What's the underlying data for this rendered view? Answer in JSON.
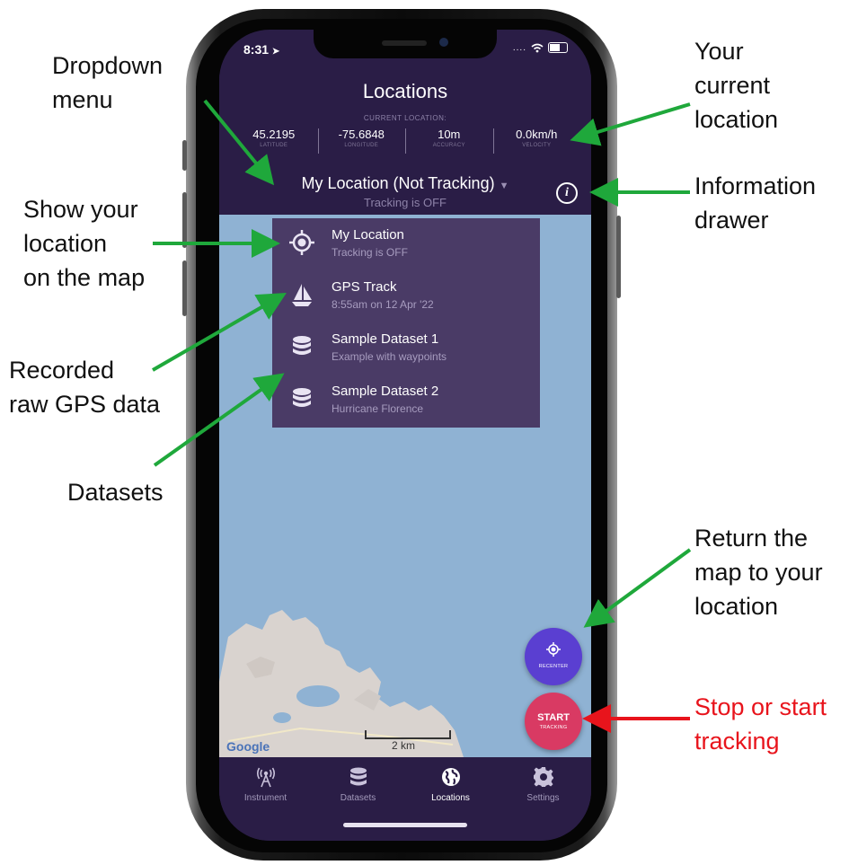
{
  "status_bar": {
    "time": "8:31",
    "signal": "...."
  },
  "header": {
    "title": "Locations",
    "current_location_label": "CURRENT LOCATION:",
    "stats": [
      {
        "value": "45.2195",
        "label": "LATITUDE"
      },
      {
        "value": "-75.6848",
        "label": "LONGITUDE"
      },
      {
        "value": "10m",
        "label": "ACCURACY"
      },
      {
        "value": "0.0km/h",
        "label": "VELOCITY"
      }
    ],
    "dropdown": {
      "title": "My Location (Not Tracking)",
      "caret": "▼",
      "subtitle": "Tracking is OFF"
    },
    "info_button": "i"
  },
  "menu": {
    "items": [
      {
        "title": "My Location",
        "subtitle": "Tracking is OFF",
        "icon": "crosshair-icon"
      },
      {
        "title": "GPS Track",
        "subtitle": "8:55am on 12 Apr '22",
        "icon": "sailboat-icon"
      },
      {
        "title": "Sample Dataset 1",
        "subtitle": "Example with waypoints",
        "icon": "database-icon"
      },
      {
        "title": "Sample Dataset 2",
        "subtitle": "Hurricane Florence",
        "icon": "database-icon"
      }
    ]
  },
  "map": {
    "attribution": "Google",
    "scale": "2 km",
    "water_color": "#8fb2d3",
    "land_color": "#d9d3cf"
  },
  "buttons": {
    "recenter": {
      "title": "",
      "sub": "RECENTER",
      "color": "#5a3fd1"
    },
    "start": {
      "title": "START",
      "sub": "TRACKING",
      "color": "#d93a63"
    }
  },
  "tabbar": {
    "tabs": [
      {
        "label": "Instrument",
        "icon": "antenna-icon",
        "active": false
      },
      {
        "label": "Datasets",
        "icon": "database-icon",
        "active": false
      },
      {
        "label": "Locations",
        "icon": "globe-icon",
        "active": true
      },
      {
        "label": "Settings",
        "icon": "gear-icon",
        "active": false
      }
    ]
  },
  "annotations": {
    "dropdown_menu": "Dropdown\nmenu",
    "current_location": "Your\ncurrent\nlocation",
    "information_drawer": "Information\ndrawer",
    "show_location": "Show your\nlocation\non the map",
    "recorded_gps": "Recorded\nraw GPS data",
    "datasets": "Datasets",
    "return_map": "Return the\nmap to your\nlocation",
    "stop_start": "Stop or start\ntracking"
  },
  "colors": {
    "app_bg": "#2a1d46",
    "menu_bg": "#4a3b66",
    "arrow_green": "#1fa83b",
    "arrow_red": "#e8141c"
  }
}
